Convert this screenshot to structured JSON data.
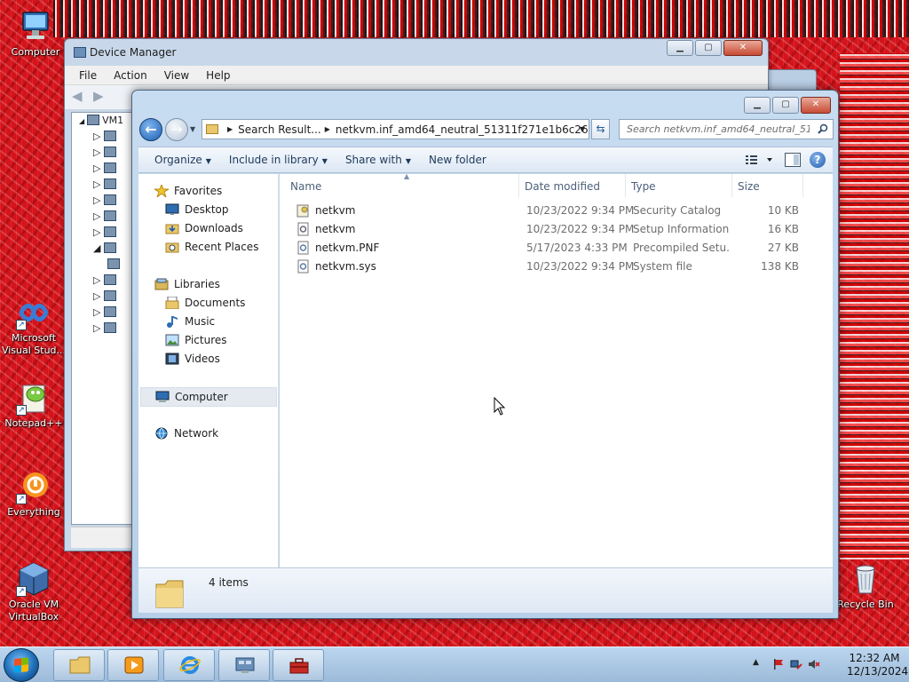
{
  "desktop": {
    "icons": [
      {
        "label": "Computer"
      },
      {
        "label": "Microsoft Visual Stud..."
      },
      {
        "label": "Notepad++"
      },
      {
        "label": "Everything"
      },
      {
        "label": "Oracle VM VirtualBox"
      },
      {
        "label": "Recycle Bin"
      }
    ]
  },
  "device_manager": {
    "title": "Device Manager",
    "menu": [
      "File",
      "Action",
      "View",
      "Help"
    ],
    "tree_root": "VM1"
  },
  "explorer": {
    "breadcrumb": [
      "Search Result...",
      "netkvm.inf_amd64_neutral_51311f271e1b6c26"
    ],
    "search_placeholder": "Search netkvm.inf_amd64_neutral_51...",
    "commands": {
      "organize": "Organize",
      "include_in_library": "Include in library",
      "share_with": "Share with",
      "new_folder": "New folder"
    },
    "nav": {
      "favorites": "Favorites",
      "desktop": "Desktop",
      "downloads": "Downloads",
      "recent_places": "Recent Places",
      "libraries": "Libraries",
      "documents": "Documents",
      "music": "Music",
      "pictures": "Pictures",
      "videos": "Videos",
      "computer": "Computer",
      "network": "Network"
    },
    "columns": {
      "name": "Name",
      "date_modified": "Date modified",
      "type": "Type",
      "size": "Size"
    },
    "files": [
      {
        "name": "netkvm",
        "date": "10/23/2022 9:34 PM",
        "type": "Security Catalog",
        "size": "10 KB"
      },
      {
        "name": "netkvm",
        "date": "10/23/2022 9:34 PM",
        "type": "Setup Information",
        "size": "16 KB"
      },
      {
        "name": "netkvm.PNF",
        "date": "5/17/2023 4:33 PM",
        "type": "Precompiled Setu...",
        "size": "27 KB"
      },
      {
        "name": "netkvm.sys",
        "date": "10/23/2022 9:34 PM",
        "type": "System file",
        "size": "138 KB"
      }
    ],
    "item_count": "4 items"
  },
  "taskbar": {
    "clock_time": "12:32 AM",
    "clock_date": "12/13/2024"
  },
  "colors": {
    "desktop_bg": "#d4141c",
    "accent": "#1f5cb0",
    "selection": "#e5eaf1"
  }
}
